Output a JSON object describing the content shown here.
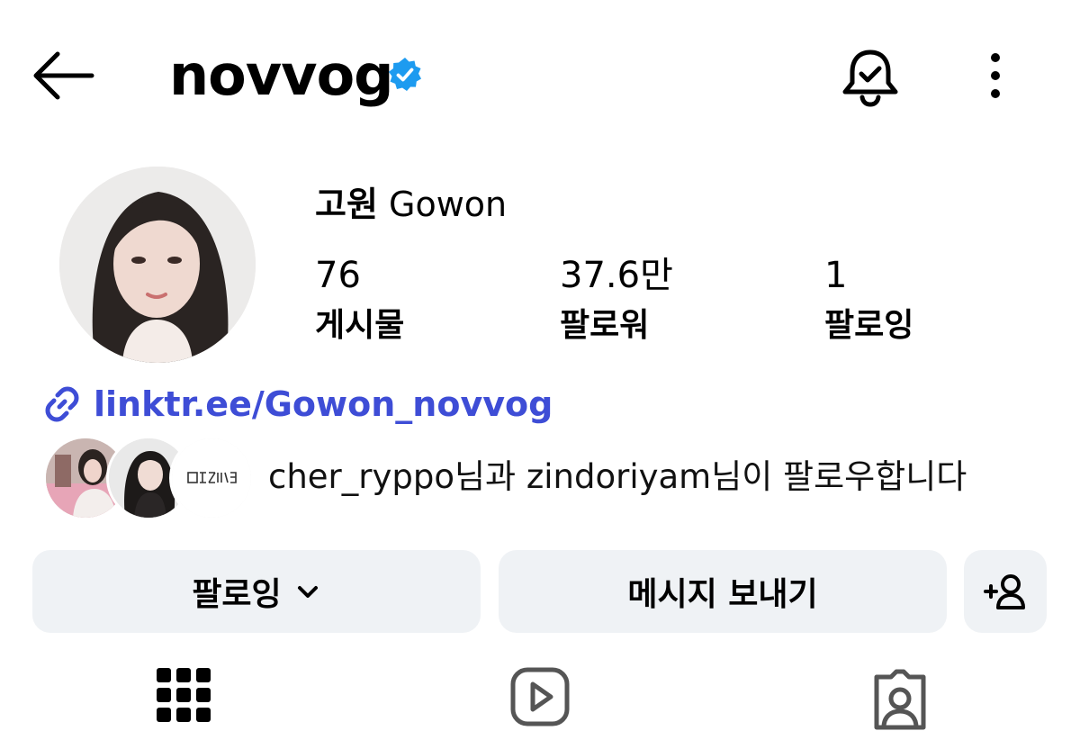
{
  "header": {
    "username": "novvog",
    "verified": true,
    "icons": {
      "back": "arrow-left-icon",
      "verified": "verified-badge-icon",
      "notifications": "bell-check-icon",
      "more": "more-vertical-icon"
    }
  },
  "profile": {
    "name_korean": "고원",
    "name_latin": "Gowon",
    "stats": [
      {
        "value": "76",
        "label": "게시물"
      },
      {
        "value": "37.6만",
        "label": "팔로워"
      },
      {
        "value": "1",
        "label": "팔로잉"
      }
    ],
    "link": "linktr.ee/Gowon_novvog",
    "followed_by_text": "cher_ryppo님과 zindoriyam님이 팔로우합니다"
  },
  "actions": {
    "following_label": "팔로잉",
    "message_label": "메시지 보내기"
  },
  "tabs": [
    "grid-icon",
    "reels-icon",
    "tagged-icon"
  ],
  "colors": {
    "link": "#3e4dd6",
    "verified": "#1d9bf0",
    "button_bg": "#eff2f5"
  }
}
